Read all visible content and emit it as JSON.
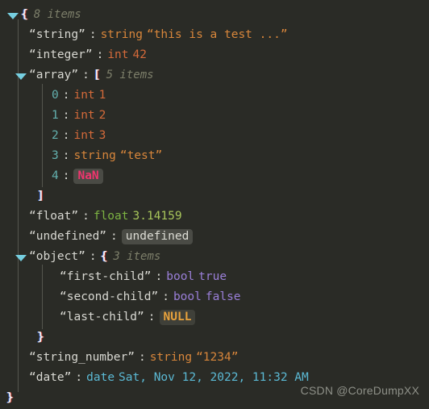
{
  "viewer": {
    "background_color": "#2a2b26",
    "watermark": "CSDN @CoreDumpXX"
  },
  "symbols": {
    "open_brace": "{",
    "close_brace": "}",
    "open_bracket": "[",
    "close_bracket": "]",
    "colon": ":",
    "twisty": "collapse-triangle-icon"
  },
  "root": {
    "brace": "{",
    "count": "8 items",
    "close": "}"
  },
  "rows": {
    "string": {
      "key": "“string”",
      "colon": ":",
      "type": "string",
      "value": "“this is a test ...”"
    },
    "integer": {
      "key": "“integer”",
      "colon": ":",
      "type": "int",
      "value": "42"
    },
    "array": {
      "key": "“array”",
      "colon": ":",
      "bracket": "[",
      "count": "5 items",
      "close": "]",
      "items": [
        {
          "index": "0",
          "colon": ":",
          "type": "int",
          "value": "1"
        },
        {
          "index": "1",
          "colon": ":",
          "type": "int",
          "value": "2"
        },
        {
          "index": "2",
          "colon": ":",
          "type": "int",
          "value": "3"
        },
        {
          "index": "3",
          "colon": ":",
          "type": "string",
          "value": "“test”"
        },
        {
          "index": "4",
          "colon": ":",
          "type": "",
          "value": "NaN"
        }
      ]
    },
    "float": {
      "key": "“float”",
      "colon": ":",
      "type": "float",
      "value": "3.14159"
    },
    "undefined": {
      "key": "“undefined”",
      "colon": ":",
      "value": "undefined"
    },
    "object": {
      "key": "“object”",
      "colon": ":",
      "brace": "{",
      "count": "3 items",
      "close": "}",
      "children": [
        {
          "key": "“first-child”",
          "colon": ":",
          "type": "bool",
          "value": "true"
        },
        {
          "key": "“second-child”",
          "colon": ":",
          "type": "bool",
          "value": "false"
        },
        {
          "key": "“last-child”",
          "colon": ":",
          "type": "",
          "value": "NULL"
        }
      ]
    },
    "string_number": {
      "key": "“string_number”",
      "colon": ":",
      "type": "string",
      "value": "“1234”"
    },
    "date": {
      "key": "“date”",
      "colon": ":",
      "type": "date",
      "value": "Sat, Nov 12, 2022, 11:32 AM"
    }
  },
  "colors": {
    "background": "#2a2b26",
    "key": "#d8d8d2",
    "string": "#d8863b",
    "int": "#d46a3a",
    "float": "#7cb342",
    "bool": "#9a7fd8",
    "date": "#5bb9d4",
    "index": "#63b0ae",
    "count": "#7d7f6a",
    "nan": "#f0356e",
    "null": "#e8a23c",
    "twisty": "#76cfe0",
    "guide": "#55564e",
    "watermark": "#8e9088"
  }
}
